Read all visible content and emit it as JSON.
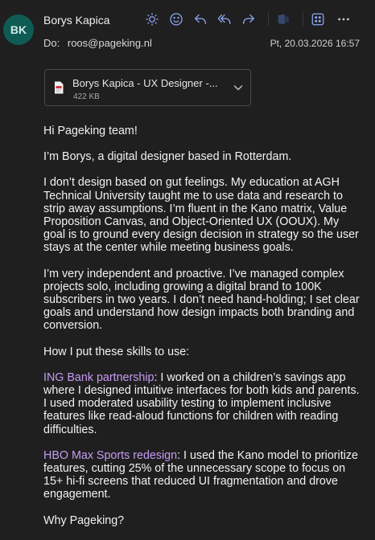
{
  "email": {
    "avatar_initials": "BK",
    "sender_name": "Borys Kapica",
    "to_label": "Do:",
    "to_address": "roos@pageking.nl",
    "date": "Pt, 20.03.2026 16:57"
  },
  "toolbar": {
    "icons": [
      "sun-icon",
      "emoji-icon",
      "reply-icon",
      "reply-all-icon",
      "forward-icon",
      "teams-icon",
      "apps-icon",
      "more-icon"
    ]
  },
  "attachment": {
    "name": "Borys Kapica - UX Designer -...",
    "size": "422 KB",
    "icon": "pdf-file-icon"
  },
  "body": {
    "greeting": "Hi Pageking team!",
    "intro": "I’m Borys, a digital designer based in Rotterdam.",
    "p1": "I don’t design based on gut feelings. My education at AGH Technical University taught me to use data and research to strip away assumptions. I’m fluent in the Kano matrix, Value Proposition Canvas, and Object-Oriented UX (OOUX). My goal is to ground every design decision in strategy so the user stays at the center while meeting business goals.",
    "p2": "I’m very independent and proactive. I’ve managed complex projects solo, including growing a digital brand to 100K subscribers in two years. I don’t need hand-holding; I set clear goals and understand how design impacts both branding and conversion.",
    "skills_intro": "How I put these skills to use:",
    "ing_title": "ING Bank partnership",
    "ing_text": ": I worked on a children’s savings app where I designed intuitive interfaces for both kids and parents. I used moderated usability testing to implement inclusive features like read-aloud functions for children with reading difficulties.",
    "hbo_title": "HBO Max Sports redesign",
    "hbo_text": ": I used the Kano model to prioritize features, cutting 25% of the unnecessary scope to focus on 15+ hi-fi screens that reduced UI fragmentation and drove engagement.",
    "why": "Why Pageking?"
  },
  "colors": {
    "background": "#1f1f1f",
    "avatar": "#0f5c55",
    "accent_icon": "#8fa8f8",
    "highlight": "#c79bf2"
  }
}
